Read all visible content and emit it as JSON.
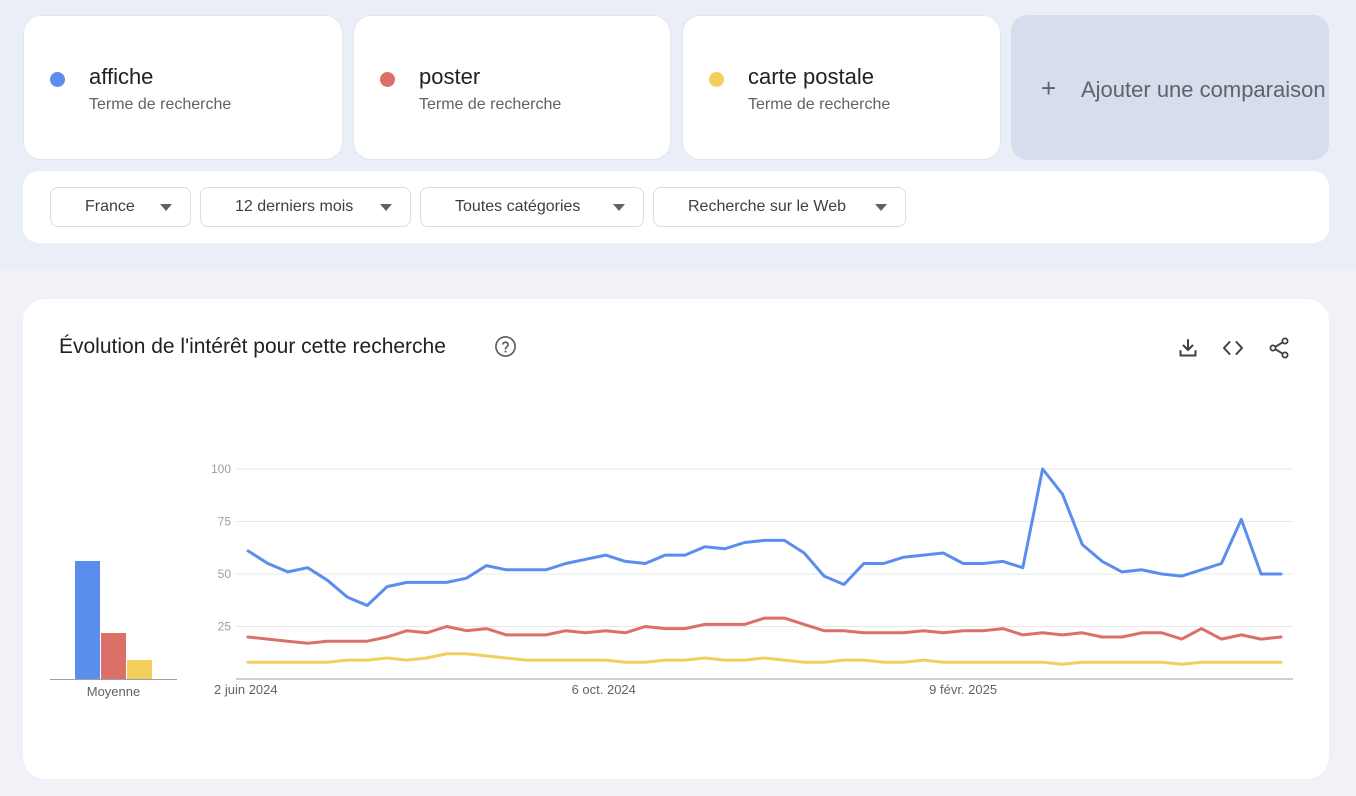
{
  "terms": [
    {
      "name": "affiche",
      "subtitle": "Terme de recherche",
      "color": "#5b8def"
    },
    {
      "name": "poster",
      "subtitle": "Terme de recherche",
      "color": "#db7068"
    },
    {
      "name": "carte postale",
      "subtitle": "Terme de recherche",
      "color": "#f2cf5b"
    }
  ],
  "add_comparison": {
    "icon": "plus-icon",
    "label": "Ajouter une comparaison"
  },
  "filters": [
    {
      "label": "France"
    },
    {
      "label": "12 derniers mois"
    },
    {
      "label": "Toutes catégories"
    },
    {
      "label": "Recherche sur le Web"
    }
  ],
  "chart_header": {
    "title": "Évolution de l'intérêt pour cette recherche",
    "help_icon": "help-icon",
    "tools": [
      "download-icon",
      "embed-code-icon",
      "share-icon"
    ]
  },
  "averages": {
    "label": "Moyenne",
    "values": [
      56,
      22,
      9
    ]
  },
  "chart_data": {
    "type": "line",
    "title": "",
    "xlabel": "",
    "ylabel": "",
    "ylim": [
      0,
      100
    ],
    "yticks": [
      25,
      50,
      75,
      100
    ],
    "x_tick_labels": [
      "2 juin 2024",
      "6 oct. 2024",
      "9 févr. 2025"
    ],
    "x_tick_indices": [
      0,
      18,
      36
    ],
    "grid": true,
    "series": [
      {
        "name": "affiche",
        "color": "#5b8def",
        "values": [
          61,
          55,
          51,
          53,
          47,
          39,
          35,
          44,
          46,
          46,
          46,
          48,
          54,
          52,
          52,
          52,
          55,
          57,
          59,
          56,
          55,
          59,
          59,
          63,
          62,
          65,
          66,
          66,
          60,
          49,
          45,
          55,
          55,
          58,
          59,
          60,
          55,
          55,
          56,
          53,
          100,
          88,
          64,
          56,
          51,
          52,
          50,
          49,
          52,
          55,
          76,
          50,
          50
        ]
      },
      {
        "name": "poster",
        "color": "#db7068",
        "values": [
          20,
          19,
          18,
          17,
          18,
          18,
          18,
          20,
          23,
          22,
          25,
          23,
          24,
          21,
          21,
          21,
          23,
          22,
          23,
          22,
          25,
          24,
          24,
          26,
          26,
          26,
          29,
          29,
          26,
          23,
          23,
          22,
          22,
          22,
          23,
          22,
          23,
          23,
          24,
          21,
          22,
          21,
          22,
          20,
          20,
          22,
          22,
          19,
          24,
          19,
          21,
          19,
          20
        ]
      },
      {
        "name": "carte postale",
        "color": "#f2cf5b",
        "values": [
          8,
          8,
          8,
          8,
          8,
          9,
          9,
          10,
          9,
          10,
          12,
          12,
          11,
          10,
          9,
          9,
          9,
          9,
          9,
          8,
          8,
          9,
          9,
          10,
          9,
          9,
          10,
          9,
          8,
          8,
          9,
          9,
          8,
          8,
          9,
          8,
          8,
          8,
          8,
          8,
          8,
          7,
          8,
          8,
          8,
          8,
          8,
          7,
          8,
          8,
          8,
          8,
          8
        ]
      }
    ]
  }
}
